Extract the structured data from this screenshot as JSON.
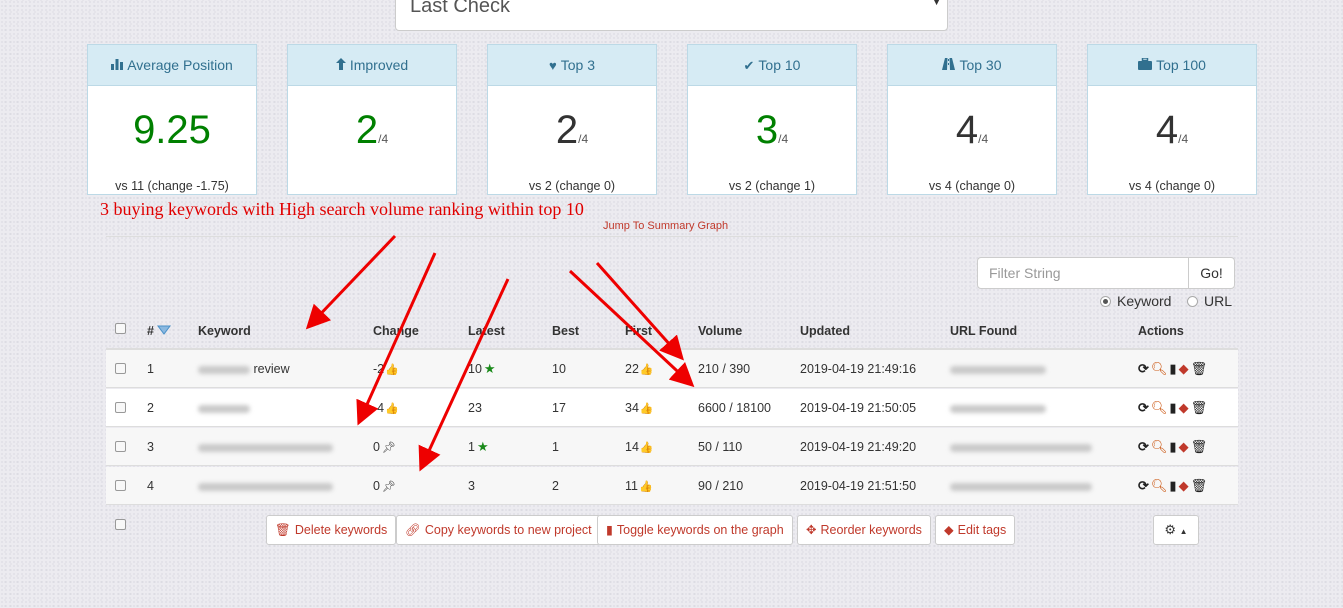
{
  "period_select": {
    "value": "Last Check"
  },
  "stats": [
    {
      "title": "Average Position",
      "icon": "bar-chart-icon",
      "glyph": "▮",
      "value": "9.25",
      "of": "",
      "compare": "vs 11 (change -1.75)",
      "value_color": "#008000"
    },
    {
      "title": "Improved",
      "icon": "arrow-up-icon",
      "glyph": "🡅",
      "value": "2",
      "of": "/4",
      "compare": "",
      "value_color": "#008000"
    },
    {
      "title": "Top 3",
      "icon": "heart-icon",
      "glyph": "♥",
      "value": "2",
      "of": "/4",
      "compare": "vs 2 (change 0)",
      "value_color": "#333333"
    },
    {
      "title": "Top 10",
      "icon": "check-icon",
      "glyph": "✔",
      "value": "3",
      "of": "/4",
      "compare": "vs 2 (change 1)",
      "value_color": "#008000"
    },
    {
      "title": "Top 30",
      "icon": "road-icon",
      "glyph": "▲",
      "value": "4",
      "of": "/4",
      "compare": "vs 4 (change 0)",
      "value_color": "#333333"
    },
    {
      "title": "Top 100",
      "icon": "briefcase-icon",
      "glyph": "▬",
      "value": "4",
      "of": "/4",
      "compare": "vs 4 (change 0)",
      "value_color": "#333333"
    }
  ],
  "annotation": "3 buying keywords with High search volume ranking within top 10",
  "jump_link": "Jump To Summary Graph",
  "filter": {
    "placeholder": "Filter String",
    "button": "Go!"
  },
  "search_mode": {
    "keyword": "Keyword",
    "url": "URL",
    "selected": "Keyword"
  },
  "table": {
    "columns": {
      "num": "#",
      "keyword": "Keyword",
      "change": "Change",
      "latest": "Latest",
      "best": "Best",
      "first": "First",
      "volume": "Volume",
      "updated": "Updated",
      "url": "URL Found",
      "actions": "Actions"
    },
    "rows": [
      {
        "num": "1",
        "keyword_suffix": "review",
        "change": "-2",
        "change_icon": "thumbs-up-icon",
        "latest": "10",
        "latest_star": true,
        "best": "10",
        "first": "22",
        "volume": "210 / 390",
        "updated": "2019-04-19 21:49:16"
      },
      {
        "num": "2",
        "keyword_suffix": "",
        "change": "-4",
        "change_icon": "thumbs-up-icon",
        "latest": "23",
        "latest_star": false,
        "best": "17",
        "first": "34",
        "volume": "6600 / 18100",
        "updated": "2019-04-19 21:50:05"
      },
      {
        "num": "3",
        "keyword_suffix": "",
        "change": "0",
        "change_icon": "pin-icon",
        "latest": "1",
        "latest_star": true,
        "best": "1",
        "first": "14",
        "volume": "50 / 110",
        "updated": "2019-04-19 21:49:20"
      },
      {
        "num": "4",
        "keyword_suffix": "",
        "change": "0",
        "change_icon": "pin-icon",
        "latest": "3",
        "latest_star": false,
        "best": "2",
        "first": "11",
        "volume": "90 / 210",
        "updated": "2019-04-19 21:51:50"
      }
    ]
  },
  "buttons": {
    "delete": "Delete keywords",
    "copy": "Copy keywords to new project",
    "toggle": "Toggle keywords on the graph",
    "reorder": "Reorder keywords",
    "tags": "Edit tags"
  },
  "colors": {
    "accent_red": "#c0392b",
    "panel_blue": "#d6ebf4",
    "green": "#008000",
    "annotation_red": "#e00000"
  }
}
